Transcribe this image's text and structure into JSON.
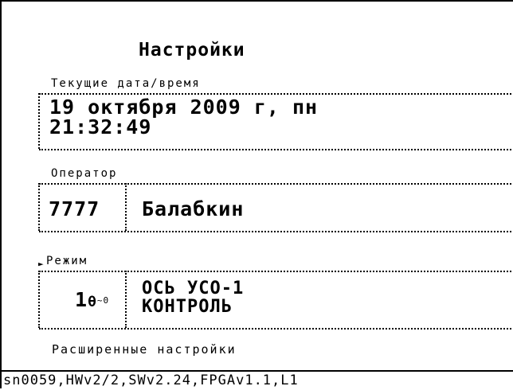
{
  "screen": {
    "title": "Настройки",
    "datetime": {
      "label": "Текущие дата/время",
      "date": "19 октября 2009 г, пн",
      "time": "21:32:49"
    },
    "operator": {
      "label": "Оператор",
      "id": "7777",
      "name": "Балабкин"
    },
    "mode": {
      "label": "Режим",
      "marker": "►",
      "number": "1",
      "symbol": "θ",
      "symbol_sub": "~0",
      "line1": "ОСЬ УСО-1",
      "line2": "КОНТРОЛЬ"
    },
    "advanced": "Расширенные настройки"
  },
  "status_bar": "sn0059,HWv2/2,SWv2.24,FPGAv1.1,L1"
}
